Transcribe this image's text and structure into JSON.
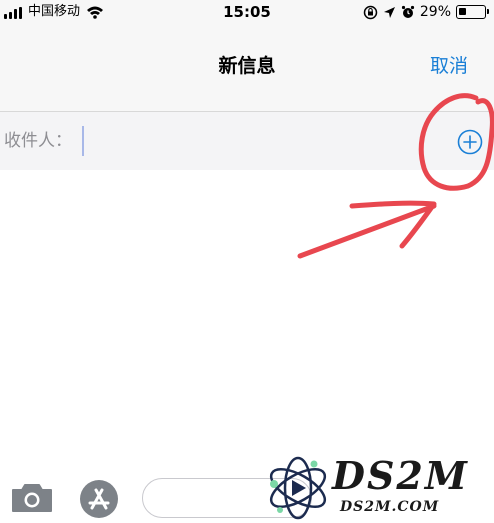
{
  "status_bar": {
    "carrier": "中国移动",
    "time": "15:05",
    "battery_percent": "29%",
    "battery_level": 0.29,
    "icons": [
      "signal-icon",
      "wifi-icon",
      "lock-rotation-icon",
      "location-icon",
      "alarm-icon",
      "battery-icon"
    ]
  },
  "nav": {
    "title": "新信息",
    "cancel_label": "取消"
  },
  "recipient": {
    "label": "收件人：",
    "value": ""
  },
  "actions": {
    "add_contact_icon": "plus-circle-icon",
    "camera_icon": "camera-icon",
    "appstore_icon": "app-store-icon"
  },
  "colors": {
    "accent": "#1a7fd6",
    "annotation": "#e8474f",
    "background": "#ffffff",
    "bar_background": "#f7f7f7",
    "label_gray": "#8e8e93"
  },
  "watermark": {
    "title": "DS2M",
    "subtitle": "DS2M.COM"
  }
}
